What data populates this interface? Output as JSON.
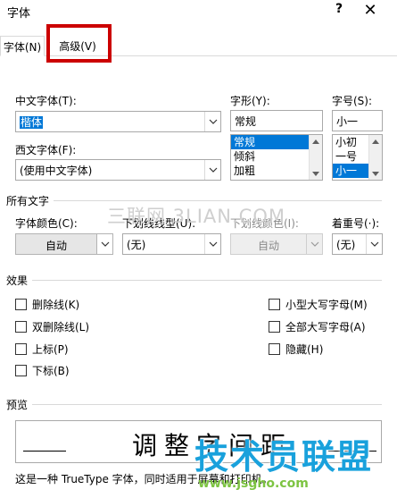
{
  "dialog": {
    "title": "字体",
    "help": "?",
    "close": "✕"
  },
  "tabs": [
    {
      "label": "字体(N)",
      "active": true
    },
    {
      "label": "高级(V)",
      "active": false
    }
  ],
  "font_section": {
    "chinese_font_label": "中文字体(T):",
    "chinese_font_value": "楷体",
    "western_font_label": "西文字体(F):",
    "western_font_value": "(使用中文字体)",
    "style_label": "字形(Y):",
    "style_value": "常规",
    "style_options": [
      "常规",
      "倾斜",
      "加粗"
    ],
    "style_selected": "常规",
    "size_label": "字号(S):",
    "size_value": "小一",
    "size_options": [
      "小初",
      "一号",
      "小一"
    ],
    "size_selected": "小一"
  },
  "all_text": {
    "title": "所有文字",
    "font_color_label": "字体颜色(C):",
    "font_color_value": "自动",
    "underline_style_label": "下划线线型(U):",
    "underline_style_value": "(无)",
    "underline_color_label": "下划线颜色(I):",
    "underline_color_value": "自动",
    "emphasis_label": "着重号(·):",
    "emphasis_value": "(无)"
  },
  "effects": {
    "title": "效果",
    "left": [
      "删除线(K)",
      "双删除线(L)",
      "上标(P)",
      "下标(B)"
    ],
    "right": [
      "小型大写字母(M)",
      "全部大写字母(A)",
      "隐藏(H)"
    ]
  },
  "preview": {
    "title": "预览",
    "sample_text": "调整字间距",
    "footnote": "这是一种 TrueType 字体，同时适用于屏幕和打印机。"
  },
  "watermarks": {
    "center": "三联网 3LIAN.COM",
    "logo": "技术员联盟",
    "url": "www.jsgho.com"
  },
  "colors": {
    "selection": "#0078d7",
    "highlight_box": "#cc0000",
    "logo": "#19a1dc",
    "url": "#7dc442"
  }
}
